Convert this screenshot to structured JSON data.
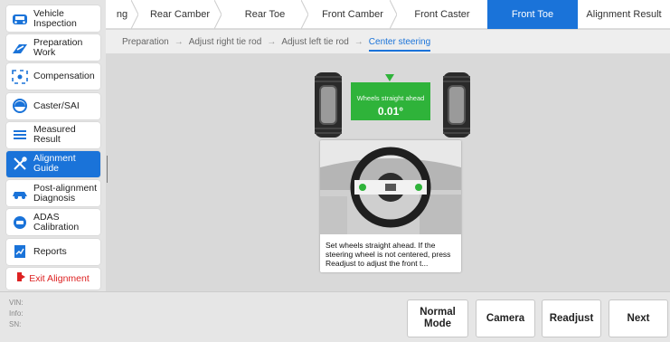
{
  "sidebar": {
    "items": [
      {
        "label": "Vehicle Inspection",
        "icon": "car-front-icon"
      },
      {
        "label": "Preparation Work",
        "icon": "wrench-plate-icon"
      },
      {
        "label": "Compensation",
        "icon": "target-arrows-icon"
      },
      {
        "label": "Caster/SAI",
        "icon": "gauge-icon"
      },
      {
        "label": "Measured Result",
        "icon": "list-icon"
      },
      {
        "label": "Alignment Guide",
        "icon": "tools-icon"
      },
      {
        "label": "Post-alignment Diagnosis",
        "icon": "car-side-icon"
      },
      {
        "label": "ADAS Calibration",
        "icon": "radar-icon"
      },
      {
        "label": "Reports",
        "icon": "report-icon"
      }
    ],
    "exit_label": "Exit Alignment"
  },
  "tabs": [
    "ng",
    "Rear Camber",
    "Rear Toe",
    "Front Camber",
    "Front Caster",
    "Front Toe",
    "Alignment Result"
  ],
  "active_tab": "Front Toe",
  "substeps": [
    "Preparation",
    "Adjust right tie rod",
    "Adjust left tie rod",
    "Center steering"
  ],
  "main": {
    "status_label": "Wheels straight ahead",
    "value": "0.01°",
    "instruction": "Set wheels straight ahead. If the steering wheel is not centered, press Readjust to adjust the front t..."
  },
  "bottom": {
    "vin_label": "VIN:",
    "info_label": "Info:",
    "sn_label": "SN:",
    "buttons": {
      "normal_mode": "Normal Mode",
      "camera": "Camera",
      "readjust": "Readjust",
      "next": "Next"
    }
  },
  "colors": {
    "accent": "#1a73d9",
    "ok": "#2fb33a",
    "exit": "#dd2222"
  }
}
